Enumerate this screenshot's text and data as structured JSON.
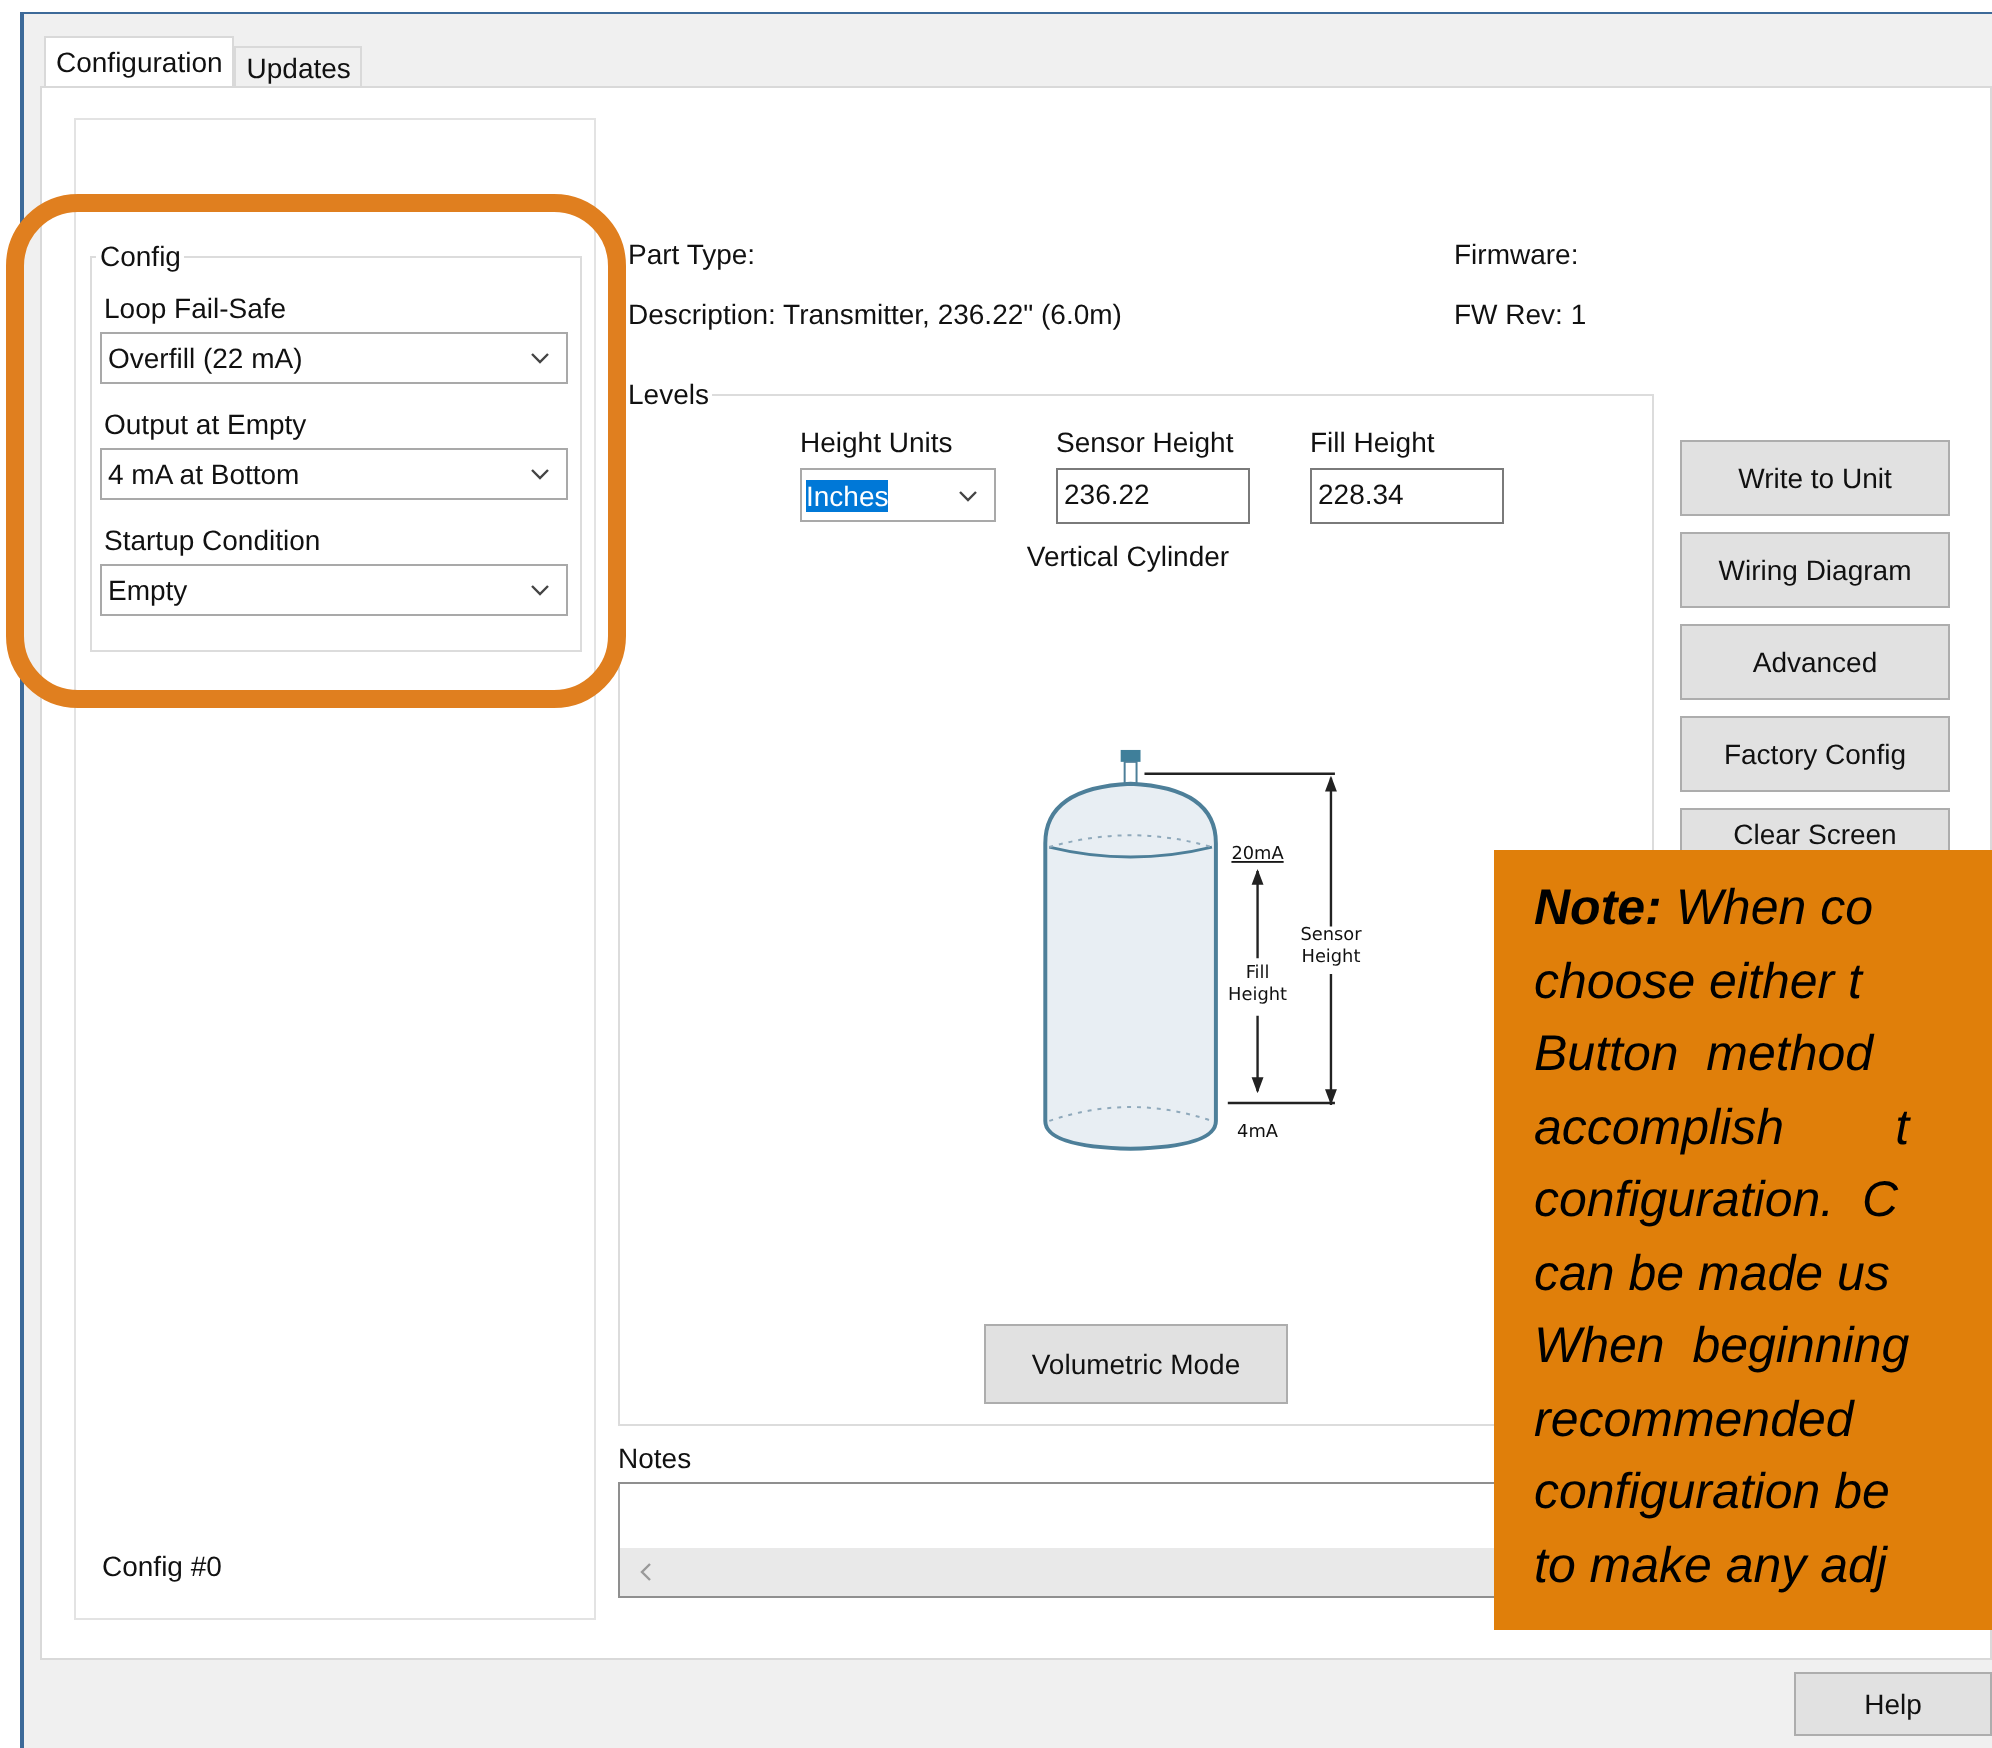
{
  "tabs": [
    {
      "label": "Configuration",
      "selected": true
    },
    {
      "label": "Updates",
      "selected": false
    }
  ],
  "config": {
    "title": "Config",
    "fields": [
      {
        "label": "Loop Fail-Safe",
        "value": "Overfill (22 mA)"
      },
      {
        "label": "Output at Empty",
        "value": "4 mA at Bottom"
      },
      {
        "label": "Startup Condition",
        "value": "Empty"
      }
    ],
    "footer": "Config #0"
  },
  "info": {
    "part_type": "Part Type:",
    "description": "Description: Transmitter, 236.22\" (6.0m)",
    "firmware": "Firmware:",
    "fw_rev": "FW Rev:  1"
  },
  "levels": {
    "title": "Levels",
    "height_units": {
      "label": "Height Units",
      "value": "Inches",
      "text_selected": true
    },
    "sensor_height": {
      "label": "Sensor Height",
      "value": "236.22"
    },
    "fill_height": {
      "label": "Fill Height",
      "value": "228.34"
    },
    "shape": "Vertical Cylinder",
    "diagram": {
      "top_label": "20mA",
      "fill_label": "Fill Height",
      "sensor_label": "Sensor Height",
      "bottom_label": "4mA"
    },
    "mode_button": "Volumetric Mode"
  },
  "buttons": [
    "Write to Unit",
    "Wiring Diagram",
    "Advanced",
    "Factory Config",
    "Clear Screen"
  ],
  "notes": {
    "label": "Notes"
  },
  "help_button": "Help",
  "note_overlay": {
    "lines": [
      "**Note:** When co",
      "choose either t",
      "Button  method",
      "accomplish        t",
      "configuration.  C",
      "can be made us",
      "When  beginning",
      "recommended",
      "configuration be",
      "to make any adj"
    ]
  }
}
